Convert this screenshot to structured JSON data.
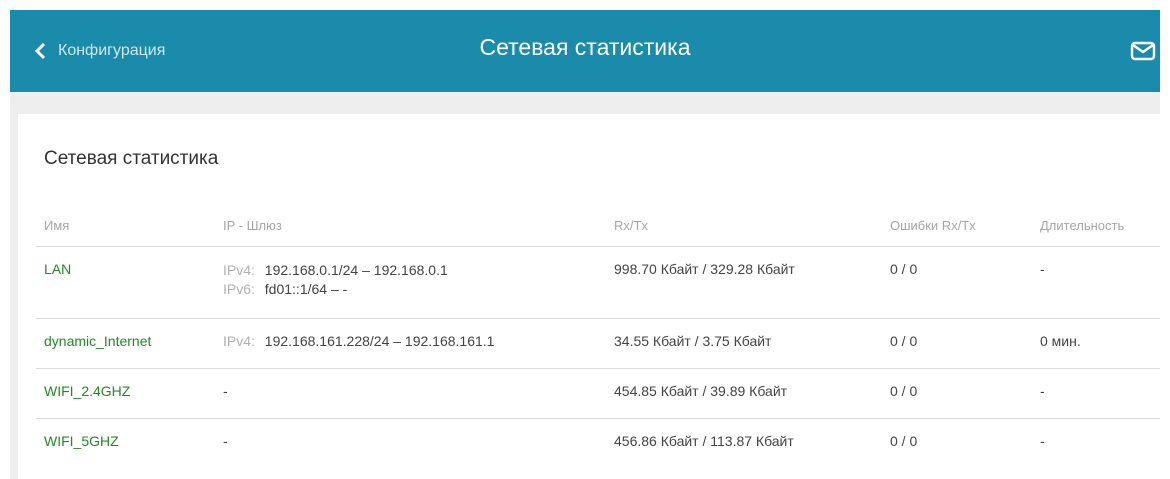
{
  "header": {
    "back_label": "Конфигурация",
    "title": "Сетевая статистика"
  },
  "card": {
    "title": "Сетевая статистика",
    "columns": [
      "Имя",
      "IP - Шлюз",
      "Rx/Tx",
      "Ошибки Rx/Tx",
      "Длительность"
    ]
  },
  "rows": [
    {
      "name": "LAN",
      "ipv4_label": "IPv4:",
      "ipv4": "192.168.0.1/24 – 192.168.0.1",
      "ipv6_label": "IPv6:",
      "ipv6": "fd01::1/64 – -",
      "rxtx": "998.70 Кбайт / 329.28 Кбайт",
      "errors": "0 / 0",
      "duration": "-"
    },
    {
      "name": "dynamic_Internet",
      "ipv4_label": "IPv4:",
      "ipv4": "192.168.161.228/24 – 192.168.161.1",
      "rxtx": "34.55 Кбайт / 3.75 Кбайт",
      "errors": "0 / 0",
      "duration": "0 мин."
    },
    {
      "name": "WIFI_2.4GHZ",
      "ip": "-",
      "rxtx": "454.85 Кбайт / 39.89 Кбайт",
      "errors": "0 / 0",
      "duration": "-"
    },
    {
      "name": "WIFI_5GHZ",
      "ip": "-",
      "rxtx": "456.86 Кбайт / 113.87 Кбайт",
      "errors": "0 / 0",
      "duration": "-"
    }
  ],
  "icons": {
    "back": "chevron-left-icon",
    "mail": "mail-icon"
  },
  "colors": {
    "header": "#1b8bab",
    "link": "#238a23"
  }
}
